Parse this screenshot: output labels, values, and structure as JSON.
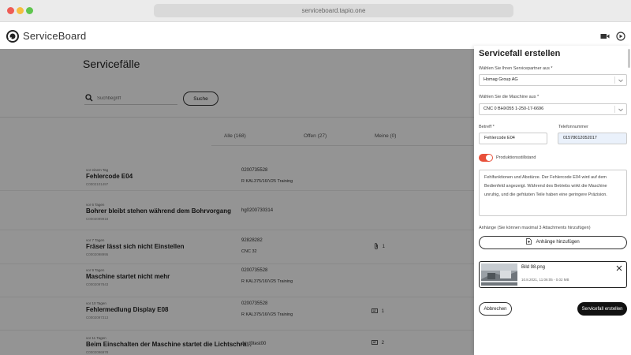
{
  "browser": {
    "url": "serviceboard.tapio.one"
  },
  "app": {
    "name": "ServiceBoard"
  },
  "main": {
    "title": "Servicefälle",
    "search": {
      "placeholder": "Suchbegriff",
      "button": "Suche"
    },
    "tabs": [
      {
        "label": "Alle (168)"
      },
      {
        "label": "Offen (27)"
      },
      {
        "label": "Meine (0)"
      }
    ],
    "rows": [
      {
        "time": "vor einem Tag",
        "title": "Fehlercode E04",
        "id": "C0002101497",
        "col1": "0200735528",
        "col2": "R KAL375/16/V25 Training",
        "attach": ""
      },
      {
        "time": "vor 6 Tagen",
        "title": "Bohrer bleibt stehen während dem Bohrvorgang",
        "id": "C0002099918",
        "col1": "hg0200730314",
        "col2": "",
        "attach": ""
      },
      {
        "time": "vor 7 Tagen",
        "title": "Fräser lässt sich nicht Einstellen",
        "id": "C0002098995",
        "col1": "92828282",
        "col2": "CNC 32",
        "attach": "1"
      },
      {
        "time": "vor 9 Tagen",
        "title": "Maschine startet nicht mehr",
        "id": "C0002097843",
        "col1": "0200735528",
        "col2": "R KAL375/16/V25 Training",
        "attach": ""
      },
      {
        "time": "vor 10 Tagen",
        "title": "Fehlermedlung Display E08",
        "id": "C0002097313",
        "col1": "0200735528",
        "col2": "R KAL375/16/V25 Training",
        "attach": "1"
      },
      {
        "time": "vor 11 Tagen",
        "title": "Beim Einschalten der Maschine startet die Lichtschra...",
        "id": "C0002096978",
        "col1": "dmd0test00",
        "col2": "",
        "attach": "2"
      }
    ]
  },
  "panel": {
    "title": "Servicefall erstellen",
    "partner_label": "Wählen Sie Ihren Servicepartner aus *",
    "partner_value": "Homag Group AG",
    "machine_label": "Wählen Sie die Maschine aus *",
    "machine_value": "CNC 0 BHX055 1-250-17-6696",
    "subject_label": "Betreff *",
    "subject_value": "Fehlercode E04",
    "phone_label": "Telefonnummer",
    "phone_value": "01578012052017",
    "production_stop_label": "Produktionsstillstand",
    "production_stop_on": true,
    "description": "Fehlfunktionen und Abstürze. Der Fehlercode E04 wird auf dem Bedienfeld angezeigt. Während des Betriebs wirkt die Maschine unruhig, und die gefrästen Teile haben eine geringere Präzision.",
    "attachments_label": "Anhänge (Sie können maximal 3 Attachments hinzufügen)",
    "add_attachment": "Anhänge hinzufügen",
    "file": {
      "name": "Bild 98.png",
      "meta": "10.8.2021, 11:06:05 - 0.02 MB"
    },
    "cancel": "Abbrechen",
    "submit": "Servicefall erstellen"
  },
  "colors": {
    "toggle_accent": "#e8503a",
    "primary_button": "#111111",
    "phone_field_bg": "#eaf1fb"
  }
}
